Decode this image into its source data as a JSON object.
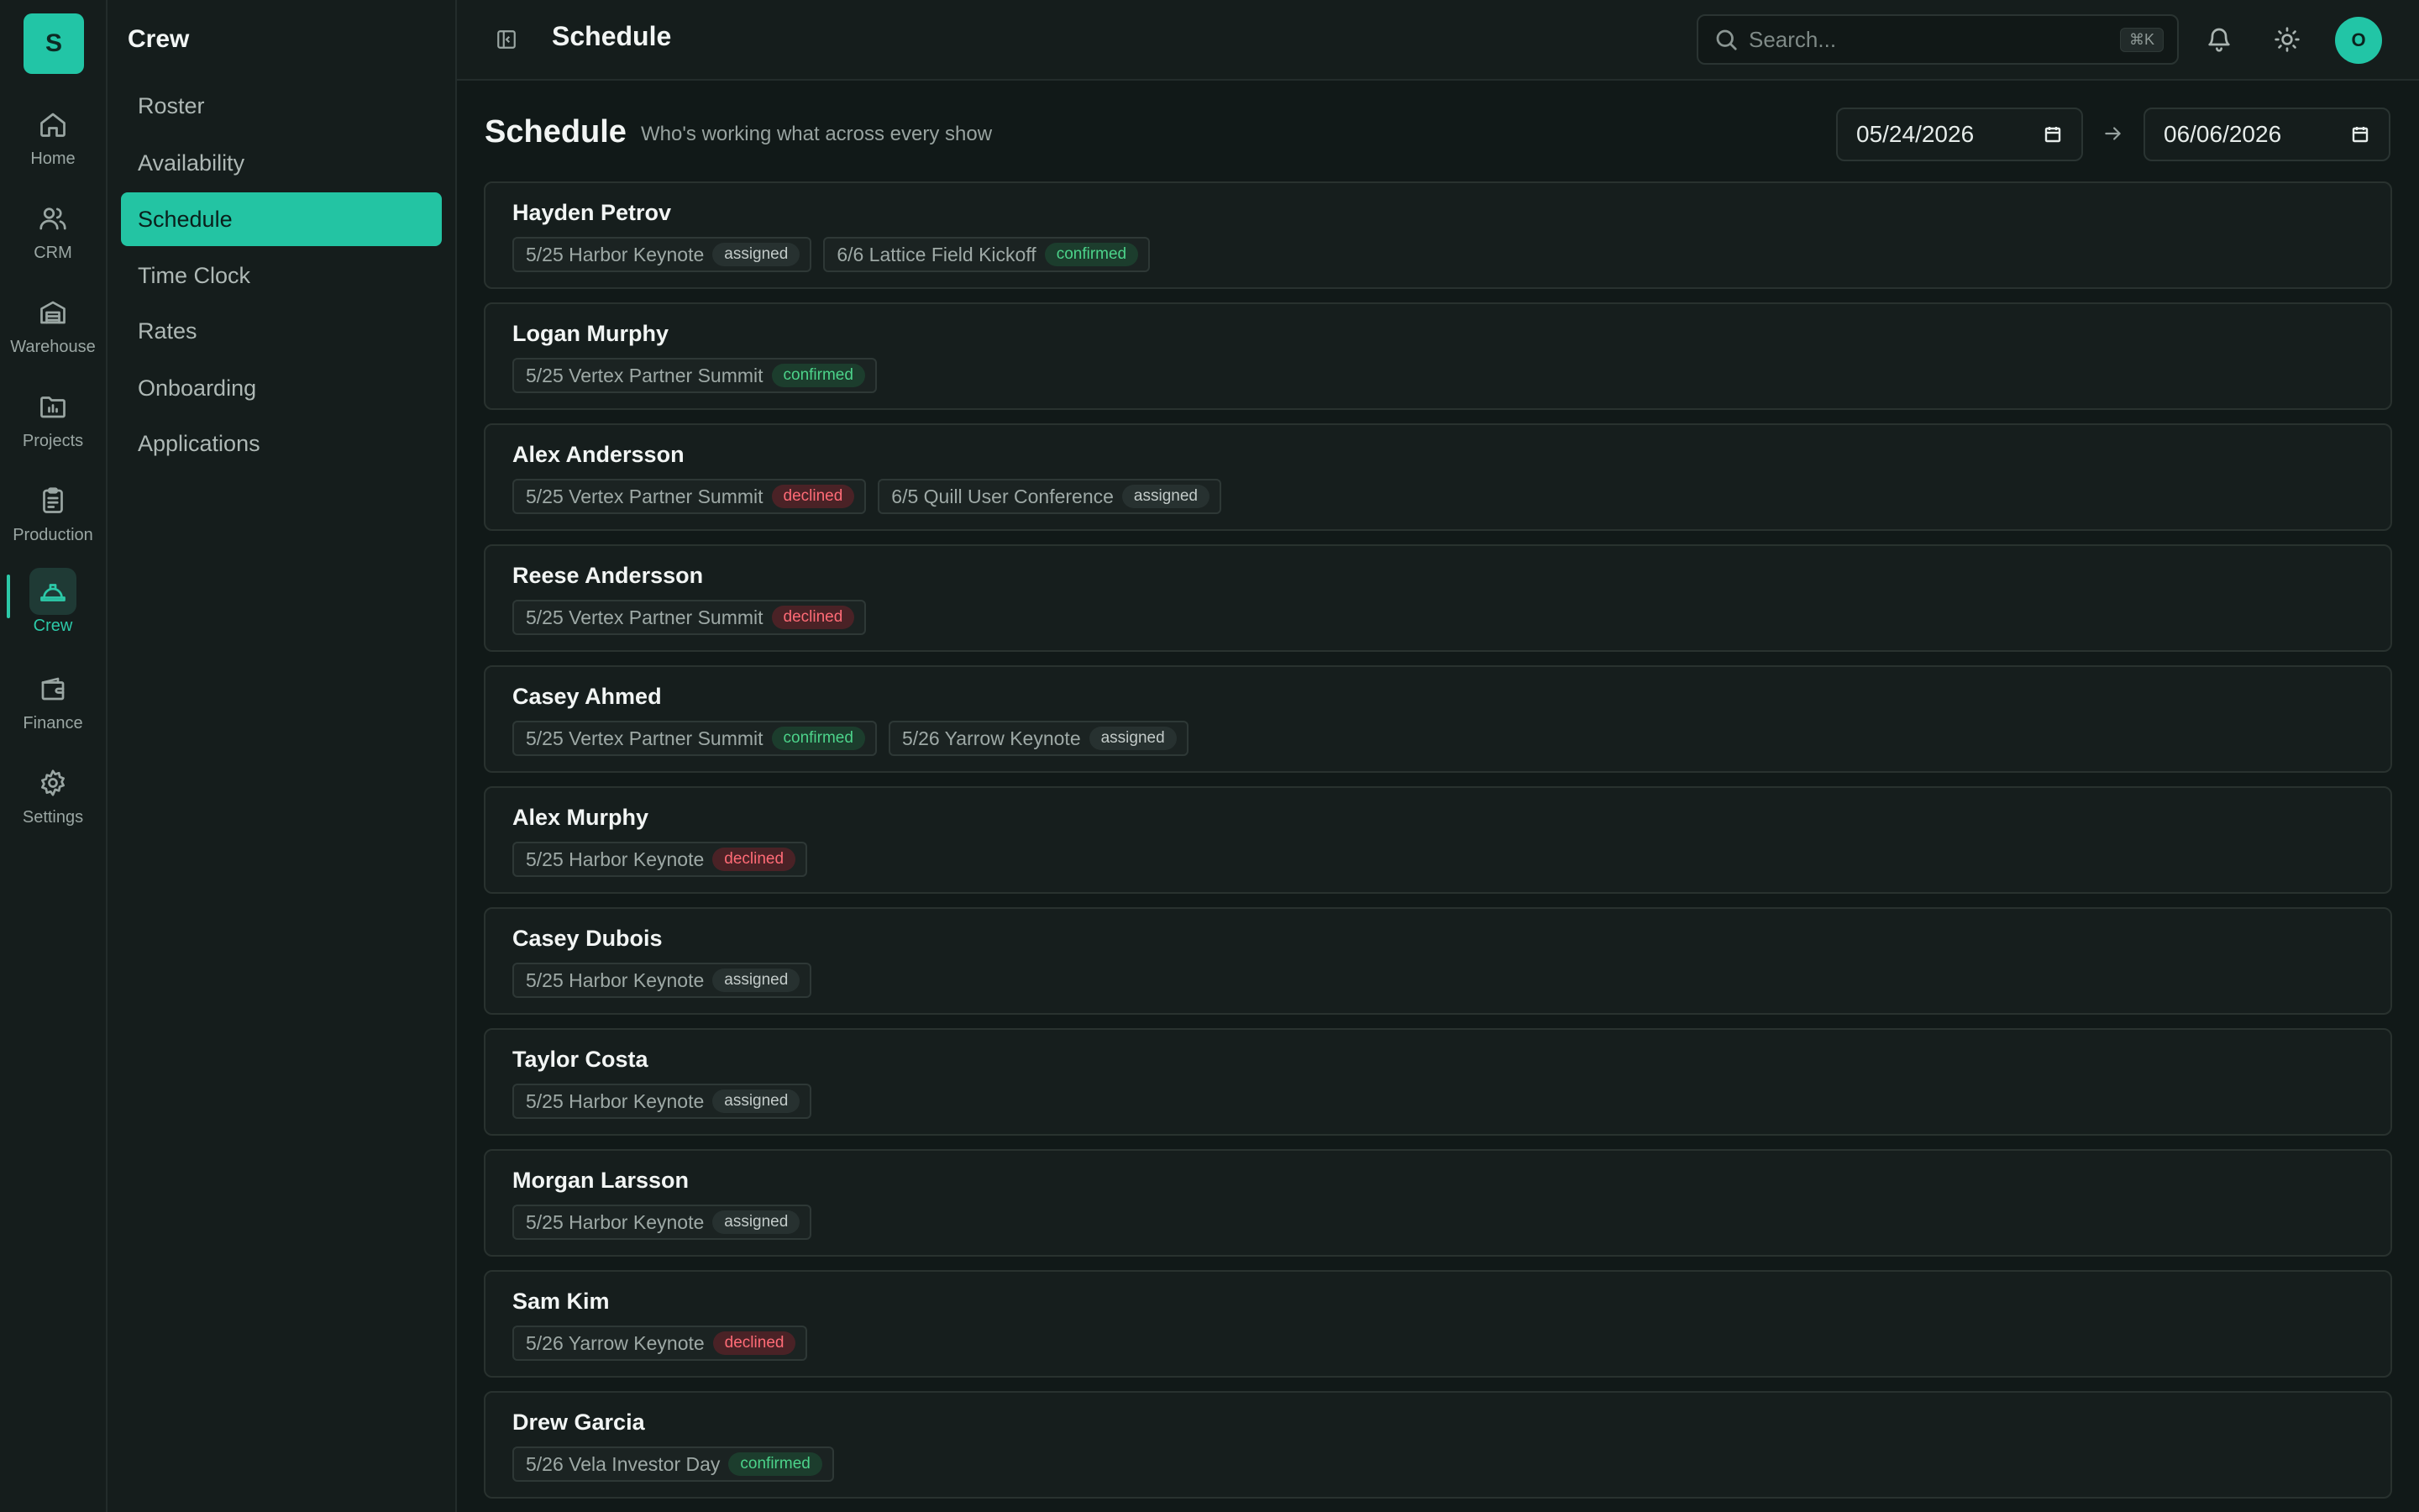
{
  "app": {
    "logo_letter": "S"
  },
  "rail": [
    {
      "label": "Home",
      "icon": "home-icon"
    },
    {
      "label": "CRM",
      "icon": "users-icon"
    },
    {
      "label": "Warehouse",
      "icon": "warehouse-icon"
    },
    {
      "label": "Projects",
      "icon": "folder-icon"
    },
    {
      "label": "Production",
      "icon": "clipboard-icon"
    },
    {
      "label": "Crew",
      "icon": "hardhat-icon",
      "active": true
    },
    {
      "label": "Finance",
      "icon": "wallet-icon"
    },
    {
      "label": "Settings",
      "icon": "gear-icon"
    }
  ],
  "subnav": {
    "title": "Crew",
    "items": [
      {
        "label": "Roster"
      },
      {
        "label": "Availability"
      },
      {
        "label": "Schedule",
        "active": true
      },
      {
        "label": "Time Clock"
      },
      {
        "label": "Rates"
      },
      {
        "label": "Onboarding"
      },
      {
        "label": "Applications"
      }
    ]
  },
  "topbar": {
    "title": "Schedule",
    "search_placeholder": "Search...",
    "search_shortcut": "⌘K",
    "avatar_letter": "O"
  },
  "page": {
    "title": "Schedule",
    "subtitle": "Who's working what across every show",
    "date_from": "05/24/2026",
    "date_to": "06/06/2026"
  },
  "colors": {
    "accent": "#22c5a6",
    "confirmed": "#4cd38a",
    "declined": "#ff6b76"
  },
  "crew": [
    {
      "name": "Hayden Petrov",
      "assignments": [
        {
          "event": "5/25 Harbor Keynote",
          "status": "assigned"
        },
        {
          "event": "6/6 Lattice Field Kickoff",
          "status": "confirmed"
        }
      ]
    },
    {
      "name": "Logan Murphy",
      "assignments": [
        {
          "event": "5/25 Vertex Partner Summit",
          "status": "confirmed"
        }
      ]
    },
    {
      "name": "Alex Andersson",
      "assignments": [
        {
          "event": "5/25 Vertex Partner Summit",
          "status": "declined"
        },
        {
          "event": "6/5 Quill User Conference",
          "status": "assigned"
        }
      ]
    },
    {
      "name": "Reese Andersson",
      "assignments": [
        {
          "event": "5/25 Vertex Partner Summit",
          "status": "declined"
        }
      ]
    },
    {
      "name": "Casey Ahmed",
      "assignments": [
        {
          "event": "5/25 Vertex Partner Summit",
          "status": "confirmed"
        },
        {
          "event": "5/26 Yarrow Keynote",
          "status": "assigned"
        }
      ]
    },
    {
      "name": "Alex Murphy",
      "assignments": [
        {
          "event": "5/25 Harbor Keynote",
          "status": "declined"
        }
      ]
    },
    {
      "name": "Casey Dubois",
      "assignments": [
        {
          "event": "5/25 Harbor Keynote",
          "status": "assigned"
        }
      ]
    },
    {
      "name": "Taylor Costa",
      "assignments": [
        {
          "event": "5/25 Harbor Keynote",
          "status": "assigned"
        }
      ]
    },
    {
      "name": "Morgan Larsson",
      "assignments": [
        {
          "event": "5/25 Harbor Keynote",
          "status": "assigned"
        }
      ]
    },
    {
      "name": "Sam Kim",
      "assignments": [
        {
          "event": "5/26 Yarrow Keynote",
          "status": "declined"
        }
      ]
    },
    {
      "name": "Drew Garcia",
      "assignments": [
        {
          "event": "5/26 Vela Investor Day",
          "status": "confirmed"
        }
      ]
    }
  ]
}
